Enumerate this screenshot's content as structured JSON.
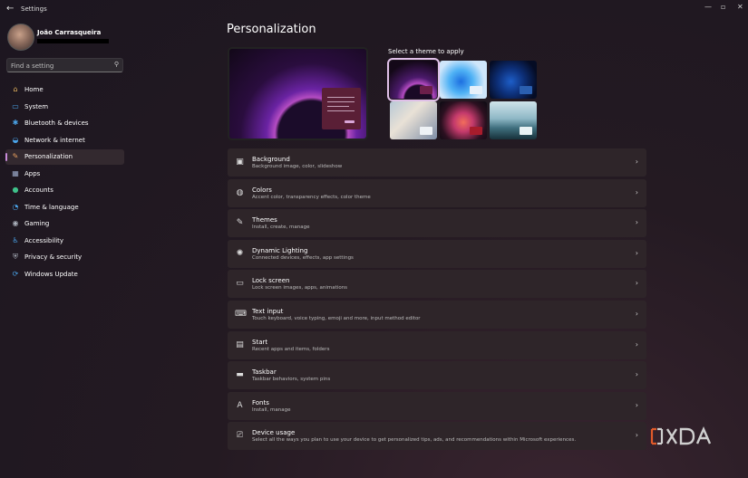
{
  "window": {
    "title": "Settings",
    "controls": {
      "minimize": "—",
      "maximize": "▫",
      "close": "✕"
    }
  },
  "profile": {
    "name": "João Carrasqueira"
  },
  "search": {
    "placeholder": "Find a setting"
  },
  "sidebar": {
    "items": [
      {
        "label": "Home",
        "icon": "home-icon",
        "glyph": "⌂",
        "color": "#e8b860"
      },
      {
        "label": "System",
        "icon": "monitor-icon",
        "glyph": "▭",
        "color": "#4aa3e8"
      },
      {
        "label": "Bluetooth & devices",
        "icon": "bluetooth-icon",
        "glyph": "✱",
        "color": "#4aa3e8"
      },
      {
        "label": "Network & internet",
        "icon": "wifi-icon",
        "glyph": "◒",
        "color": "#4aa3e8"
      },
      {
        "label": "Personalization",
        "icon": "brush-icon",
        "glyph": "✎",
        "color": "#e8a060",
        "active": true
      },
      {
        "label": "Apps",
        "icon": "apps-icon",
        "glyph": "▦",
        "color": "#9aa8c8"
      },
      {
        "label": "Accounts",
        "icon": "person-icon",
        "glyph": "●",
        "color": "#3fc08a"
      },
      {
        "label": "Time & language",
        "icon": "globe-clock-icon",
        "glyph": "◔",
        "color": "#4aa3e8"
      },
      {
        "label": "Gaming",
        "icon": "controller-icon",
        "glyph": "◉",
        "color": "#aab0bb"
      },
      {
        "label": "Accessibility",
        "icon": "accessibility-icon",
        "glyph": "♿",
        "color": "#4aa3e8"
      },
      {
        "label": "Privacy & security",
        "icon": "shield-icon",
        "glyph": "⛨",
        "color": "#aab0bb"
      },
      {
        "label": "Windows Update",
        "icon": "update-icon",
        "glyph": "⟳",
        "color": "#4aa3e8"
      }
    ]
  },
  "main": {
    "title": "Personalization",
    "themes_label": "Select a theme to apply",
    "rows": [
      {
        "title": "Background",
        "subtitle": "Background image, color, slideshow",
        "icon": "picture-icon",
        "glyph": "▣"
      },
      {
        "title": "Colors",
        "subtitle": "Accent color, transparency effects, color theme",
        "icon": "palette-icon",
        "glyph": "◍"
      },
      {
        "title": "Themes",
        "subtitle": "Install, create, manage",
        "icon": "pen-icon",
        "glyph": "✎"
      },
      {
        "title": "Dynamic Lighting",
        "subtitle": "Connected devices, effects, app settings",
        "icon": "sun-icon",
        "glyph": "✺"
      },
      {
        "title": "Lock screen",
        "subtitle": "Lock screen images, apps, animations",
        "icon": "lock-screen-icon",
        "glyph": "▭"
      },
      {
        "title": "Text input",
        "subtitle": "Touch keyboard, voice typing, emoji and more, input method editor",
        "icon": "keyboard-icon",
        "glyph": "⌨"
      },
      {
        "title": "Start",
        "subtitle": "Recent apps and items, folders",
        "icon": "start-icon",
        "glyph": "▤"
      },
      {
        "title": "Taskbar",
        "subtitle": "Taskbar behaviors, system pins",
        "icon": "taskbar-icon",
        "glyph": "▬"
      },
      {
        "title": "Fonts",
        "subtitle": "Install, manage",
        "icon": "font-icon",
        "glyph": "A"
      },
      {
        "title": "Device usage",
        "subtitle": "Select all the ways you plan to use your device to get personalized tips, ads, and recommendations within Microsoft experiences.",
        "icon": "device-usage-icon",
        "glyph": "⎚"
      }
    ]
  },
  "colors": {
    "accent": "#c78bd9",
    "row_bg": "#2e2529"
  },
  "watermark": {
    "text": "XDA"
  }
}
